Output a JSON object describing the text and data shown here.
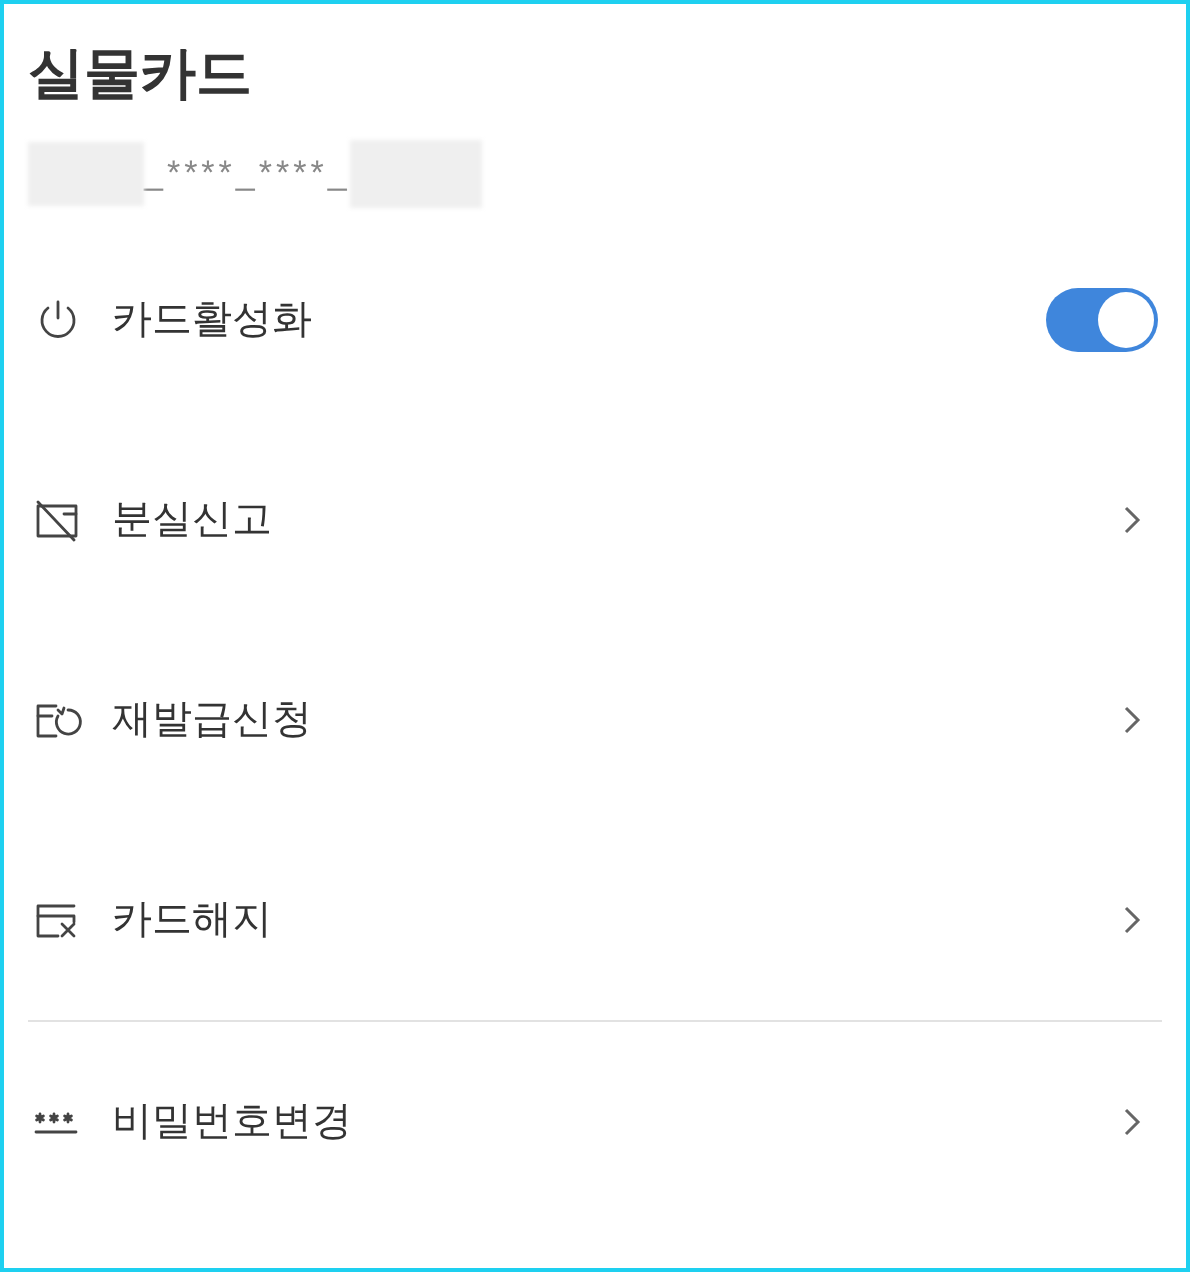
{
  "title": "실물카드",
  "card_number": {
    "masked": "_****_****_"
  },
  "menu": [
    {
      "label": "카드활성화",
      "kind": "toggle",
      "on": true
    },
    {
      "label": "분실신고",
      "kind": "link"
    },
    {
      "label": "재발급신청",
      "kind": "link"
    },
    {
      "label": "카드해지",
      "kind": "link"
    }
  ],
  "menu_secondary": [
    {
      "label": "비밀번호변경",
      "kind": "link"
    }
  ]
}
